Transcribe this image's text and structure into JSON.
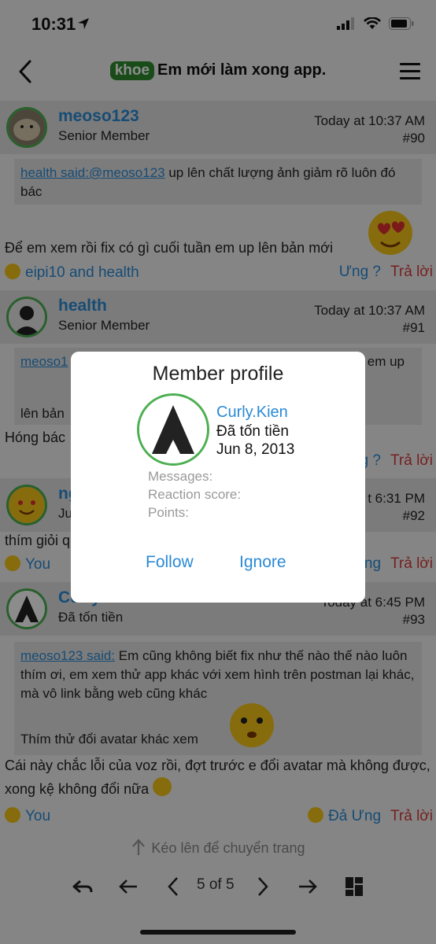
{
  "status": {
    "time": "10:31"
  },
  "nav": {
    "prefix": "khoe",
    "title": "Em mới làm xong app."
  },
  "posts": [
    {
      "username": "meoso123",
      "user_title": "Senior Member",
      "date": "Today at 10:37 AM",
      "number": "#90",
      "quote_author": "health said:@meoso123",
      "quote_text": " up lên chất lượng ảnh giảm rõ luôn đó bác",
      "message": "Để em xem rồi fix có gì cuối tuần em up lên bản mới",
      "reactions": "eipi10 and health",
      "reaction_btn": "Ưng ?",
      "reply": "Trả lời"
    },
    {
      "username": "health",
      "user_title": "Senior Member",
      "date": "Today at 10:37 AM",
      "number": "#91",
      "quote_author": "meoso1",
      "quote_text_right": "em up",
      "quote_text_2": "lên bản",
      "message": "Hóng bác",
      "reaction_btn": "Ưng ?",
      "reply": "Trả lời"
    },
    {
      "username": "ng",
      "user_title": "Ju",
      "date": "t 6:31 PM",
      "number": "#92",
      "message": "thím giỏi q",
      "reactions": "You",
      "reaction_btn": "ng",
      "reply": "Trả lời"
    },
    {
      "username": "Curly.Kien",
      "user_title": "Đã tốn tiền",
      "date": "Today at 6:45 PM",
      "number": "#93",
      "quote_author": "meoso123 said:",
      "quote_text": " Em cũng không biết fix như thế nào thế nào luôn thím ơi, em xem thử app khác với xem hình trên postman lại khác, mà vô link bằng web cũng khác",
      "quote_text_2": "Thím thử đổi avatar khác xem",
      "message": "Cái này chắc lỗi của voz rồi, đợt trước e đổi avatar mà không được, xong kệ không đổi nữa",
      "reactions": "You",
      "reaction_btn": "Đả Ưng",
      "reply": "Trả lời"
    }
  ],
  "footer": {
    "hint": "Kéo lên để chuyển trang",
    "page_label": "5 of 5"
  },
  "modal": {
    "title": "Member profile",
    "name": "Curly.Kien",
    "user_title": "Đã tốn tiền",
    "joined": "Jun 8, 2013",
    "messages_label": "Messages:",
    "reaction_label": "Reaction score:",
    "points_label": "Points:",
    "follow": "Follow",
    "ignore": "Ignore"
  },
  "colors": {
    "accent": "#2a8ad6",
    "reply": "#d63b3b",
    "badge": "#2e8b2e",
    "avatar_ring": "#4caf50"
  }
}
